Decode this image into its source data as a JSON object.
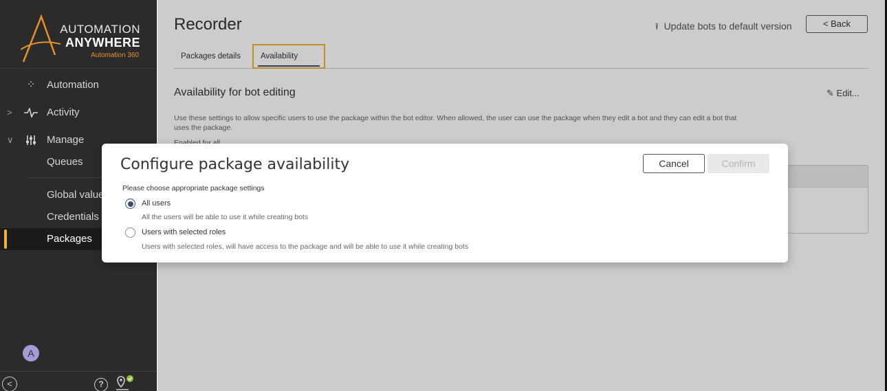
{
  "logo": {
    "line1": "AUTOMATION",
    "line2": "ANYWHERE",
    "line3": "Automation 360",
    "accent_color": "#e8912b"
  },
  "sidebar": {
    "items": [
      {
        "label": "Automation",
        "icon": "automation-icon"
      },
      {
        "label": "Activity",
        "icon": "activity-icon",
        "chevron": ">"
      },
      {
        "label": "Manage",
        "icon": "manage-sliders-icon",
        "chevron": "∨"
      },
      {
        "label": "Queues"
      },
      {
        "label": "Global value"
      },
      {
        "label": "Credentials"
      },
      {
        "label": "Packages",
        "active": true
      }
    ],
    "avatar_initial": "A",
    "active_marker_color": "#f2b32b"
  },
  "header": {
    "title": "Recorder",
    "update_link": "Update bots to default version",
    "back_label": "< Back"
  },
  "tabs": [
    {
      "label": "Packages details"
    },
    {
      "label": "Availability",
      "selected": true
    }
  ],
  "section": {
    "title": "Availability for bot editing",
    "edit_label": "Edit...",
    "description": "Use these settings to allow specific users to use the package within the bot editor. When allowed, the user can use the package when they edit a bot and they can edit a bot that uses the package.",
    "partial_label": "Enabled for all"
  },
  "modal": {
    "title": "Configure package availability",
    "cancel_label": "Cancel",
    "confirm_label": "Confirm",
    "prompt": "Please choose appropriate package settings",
    "options": [
      {
        "label": "All users",
        "description": "All the users will be able to use it while creating bots",
        "selected": true
      },
      {
        "label": "Users with selected roles",
        "description": "Users with selected roles, will have access to the package and will be able to use it while creating bots",
        "selected": false
      }
    ]
  }
}
